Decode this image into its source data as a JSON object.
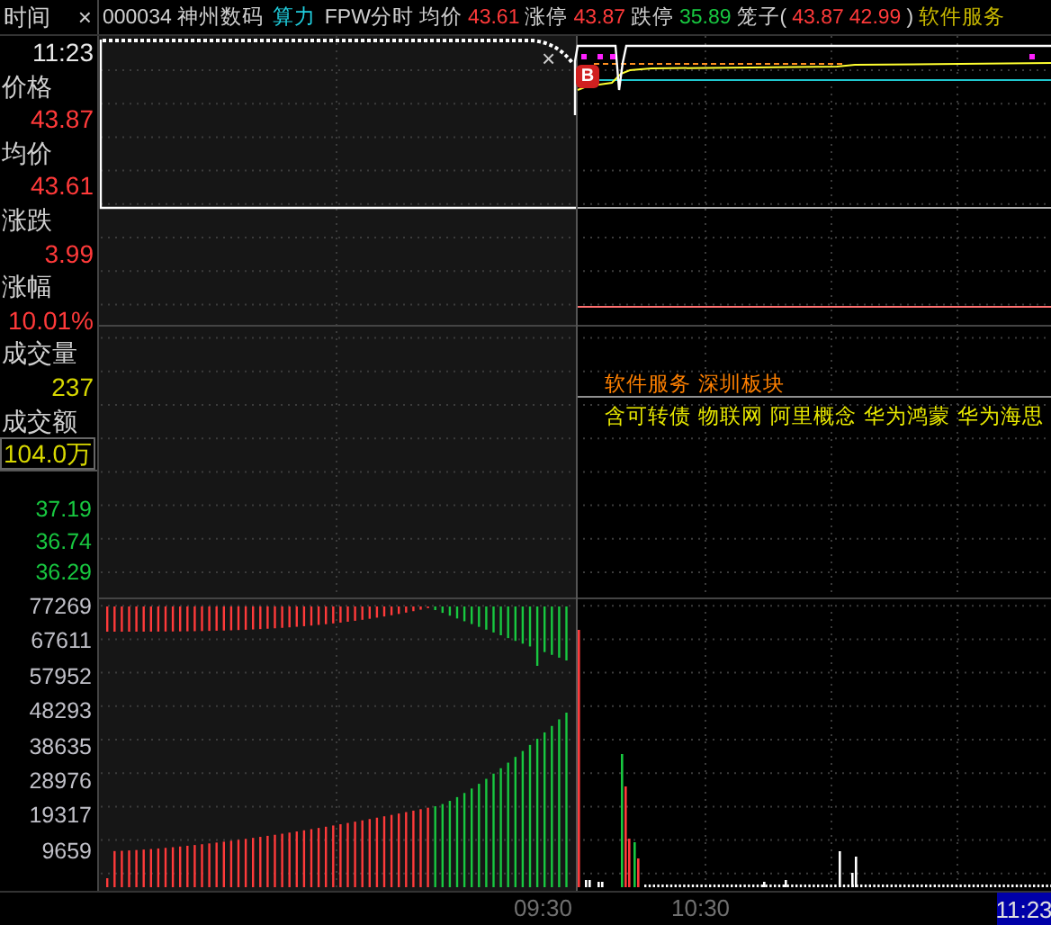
{
  "left_panel": {
    "title": "时间",
    "close": "×",
    "fields": [
      {
        "value": "11:23",
        "color": "#e8e8e8",
        "kind": "plain"
      },
      {
        "label": "价格",
        "value": "43.87",
        "color": "#ff3a3a",
        "kind": "plain"
      },
      {
        "label": "均价",
        "value": "43.61",
        "color": "#ff3a3a",
        "kind": "plain"
      },
      {
        "label": "涨跌",
        "value": "3.99",
        "color": "#ff3a3a",
        "kind": "plain"
      },
      {
        "label": "涨幅",
        "value": "10.01%",
        "color": "#ff3a3a",
        "kind": "plain"
      },
      {
        "label": "成交量",
        "value": "237",
        "color": "#d8d800",
        "kind": "plain"
      },
      {
        "label": "成交额",
        "value": "104.0万",
        "color": "#d8d800",
        "kind": "framed"
      }
    ]
  },
  "header": {
    "code": "000034",
    "name": "神州数码",
    "concept": "算力",
    "mode": "FPW分时",
    "quotes": [
      {
        "label": "均价",
        "value": "43.61",
        "color": "#ff3a3a"
      },
      {
        "label": "涨停",
        "value": "43.87",
        "color": "#ff3a3a"
      },
      {
        "label": "跌停",
        "value": "35.89",
        "color": "#18c840"
      }
    ],
    "cage": {
      "label": "笼子(",
      "values": [
        "43.87",
        "42.99"
      ],
      "suffix": ")"
    },
    "sector": "软件服务"
  },
  "chart": {
    "close": "×",
    "buy_marker": "B",
    "price_axis_labels": [
      "37.19",
      "36.74",
      "36.29"
    ],
    "volume_axis_labels": [
      "77269",
      "67611",
      "57952",
      "48293",
      "38635",
      "28976",
      "19317",
      "9659"
    ],
    "sector_tags": [
      "软件服务",
      "深圳板块"
    ],
    "concept_tags": [
      "含可转债",
      "物联网",
      "阿里概念",
      "华为鸿蒙",
      "华为海思"
    ]
  },
  "time_axis": [
    {
      "label": "09:30",
      "kind": "tick"
    },
    {
      "label": "10:30",
      "kind": "tick"
    },
    {
      "label": "11:23",
      "kind": "cursor"
    }
  ]
}
